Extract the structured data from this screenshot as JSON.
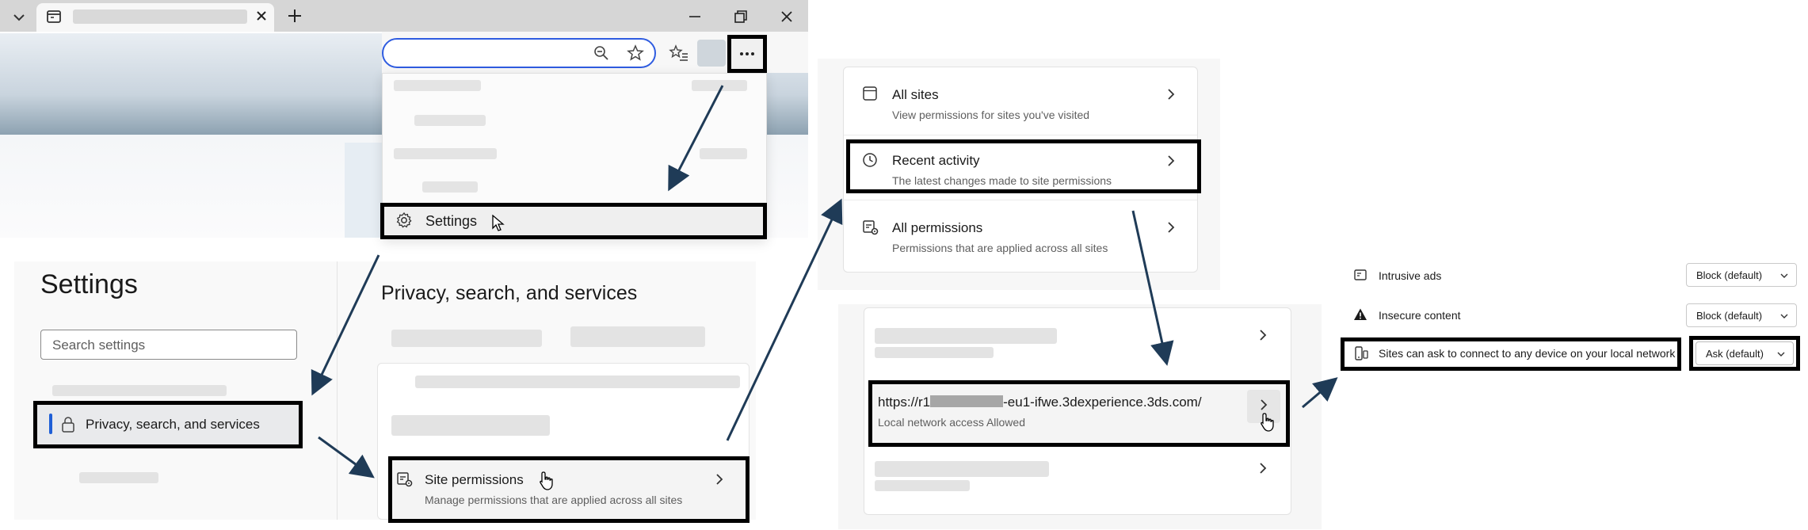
{
  "browser": {
    "menu": {
      "settings_label": "Settings"
    }
  },
  "settings_page": {
    "title": "Settings",
    "search_placeholder": "Search settings",
    "nav": {
      "privacy_label": "Privacy, search, and services"
    },
    "section_title": "Privacy, search, and services",
    "site_permissions": {
      "title": "Site permissions",
      "subtitle": "Manage permissions that are applied across all sites"
    }
  },
  "site_permissions_panel": {
    "items": [
      {
        "title": "All sites",
        "subtitle": "View permissions for sites you've visited"
      },
      {
        "title": "Recent activity",
        "subtitle": "The latest changes made to site permissions"
      },
      {
        "title": "All permissions",
        "subtitle": "Permissions that are applied across all sites"
      }
    ]
  },
  "recent_activity": {
    "url_prefix": "https://r1",
    "url_suffix": "-eu1-ifwe.3dexperience.3ds.com/",
    "url_status": "Local network access Allowed"
  },
  "site_detail": {
    "rows": [
      {
        "label": "Intrusive ads",
        "value": "Block (default)",
        "icon": "ads-icon"
      },
      {
        "label": "Insecure content",
        "value": "Block (default)",
        "icon": "warning-icon"
      },
      {
        "label": "Sites can ask to connect to any device on your local network",
        "value": "Ask (default)",
        "icon": "device-icon"
      }
    ]
  },
  "colors": {
    "highlight_border": "#000000",
    "accent": "#1f5fd6",
    "arrow": "#1f3b57"
  }
}
